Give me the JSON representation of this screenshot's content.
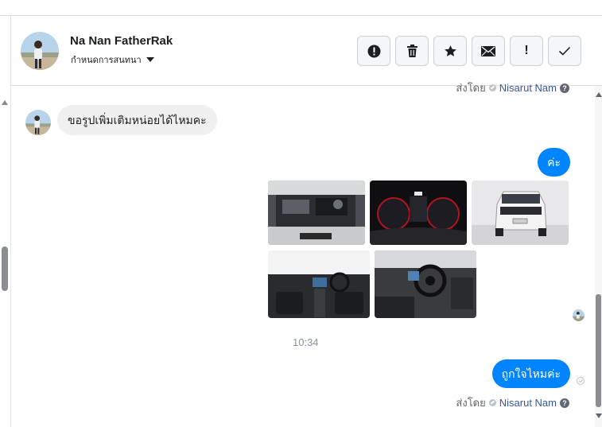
{
  "header": {
    "contact_name": "Na Nan FatherRak",
    "status_label": "กำหนดการสนทนา",
    "actions": [
      {
        "name": "report-button",
        "icon": "exclamation-circle-icon"
      },
      {
        "name": "delete-button",
        "icon": "trash-icon"
      },
      {
        "name": "star-button",
        "icon": "star-icon"
      },
      {
        "name": "mark-unread-button",
        "icon": "envelope-icon"
      },
      {
        "name": "spam-button",
        "icon": "exclamation-icon",
        "glyph": "!"
      },
      {
        "name": "done-button",
        "icon": "checkmark-icon"
      }
    ]
  },
  "conversation": {
    "sender_prefix": "ส่งโดย",
    "sender_name": "Nisarut Nam",
    "messages": [
      {
        "direction": "incoming",
        "text": "ขอรูปเพิ่มเติมหน่อยได้ไหมคะ"
      },
      {
        "direction": "outgoing",
        "text": "ค่ะ"
      },
      {
        "direction": "outgoing",
        "type": "photos",
        "count": 5
      },
      {
        "direction": "outgoing",
        "text": "ถูกใจไหมค่ะ"
      }
    ],
    "timestamp": "10:34"
  },
  "colors": {
    "outgoing_bubble": "#0084ff",
    "incoming_bubble": "#f0f0f0",
    "link": "#385898",
    "muted": "#8d949e"
  }
}
